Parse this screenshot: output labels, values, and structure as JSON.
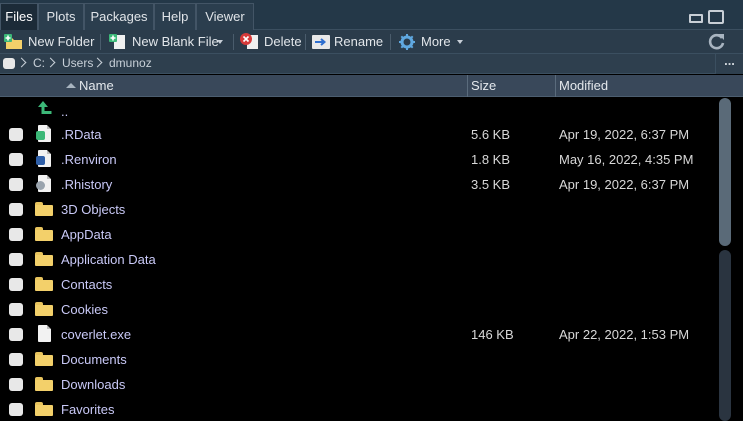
{
  "tabs": [
    {
      "label": "Files",
      "active": true
    },
    {
      "label": "Plots",
      "active": false
    },
    {
      "label": "Packages",
      "active": false
    },
    {
      "label": "Help",
      "active": false
    },
    {
      "label": "Viewer",
      "active": false
    }
  ],
  "toolbar": {
    "new_folder": "New Folder",
    "new_blank_file": "New Blank File",
    "delete": "Delete",
    "rename": "Rename",
    "more": "More"
  },
  "path": {
    "crumbs": [
      "C:",
      "Users",
      "dmunoz"
    ]
  },
  "columns": {
    "name": "Name",
    "size": "Size",
    "modified": "Modified"
  },
  "parent_dir": "..",
  "files": [
    {
      "name": ".RData",
      "size": "5.6 KB",
      "modified": "Apr 19, 2022, 6:37 PM",
      "icon": "rdata-icon"
    },
    {
      "name": ".Renviron",
      "size": "1.8 KB",
      "modified": "May 16, 2022, 4:35 PM",
      "icon": "renviron-icon"
    },
    {
      "name": ".Rhistory",
      "size": "3.5 KB",
      "modified": "Apr 19, 2022, 6:37 PM",
      "icon": "rhistory-icon"
    },
    {
      "name": "3D Objects",
      "size": "",
      "modified": "",
      "icon": "folder-icon"
    },
    {
      "name": "AppData",
      "size": "",
      "modified": "",
      "icon": "folder-icon"
    },
    {
      "name": "Application Data",
      "size": "",
      "modified": "",
      "icon": "folder-icon"
    },
    {
      "name": "Contacts",
      "size": "",
      "modified": "",
      "icon": "folder-icon"
    },
    {
      "name": "Cookies",
      "size": "",
      "modified": "",
      "icon": "folder-icon"
    },
    {
      "name": "coverlet.exe",
      "size": "146 KB",
      "modified": "Apr 22, 2022, 1:53 PM",
      "icon": "file-icon"
    },
    {
      "name": "Documents",
      "size": "",
      "modified": "",
      "icon": "folder-icon"
    },
    {
      "name": "Downloads",
      "size": "",
      "modified": "",
      "icon": "folder-icon"
    },
    {
      "name": "Favorites",
      "size": "",
      "modified": "",
      "icon": "folder-icon"
    }
  ],
  "colors": {
    "tabbar_bg": "#243848",
    "toolbar_bg": "#2b3c4b",
    "list_bg": "#000000",
    "filename_text": "#c9c9f7",
    "folder_yellow": "#f3d06a",
    "accent_green": "#3cb878"
  }
}
